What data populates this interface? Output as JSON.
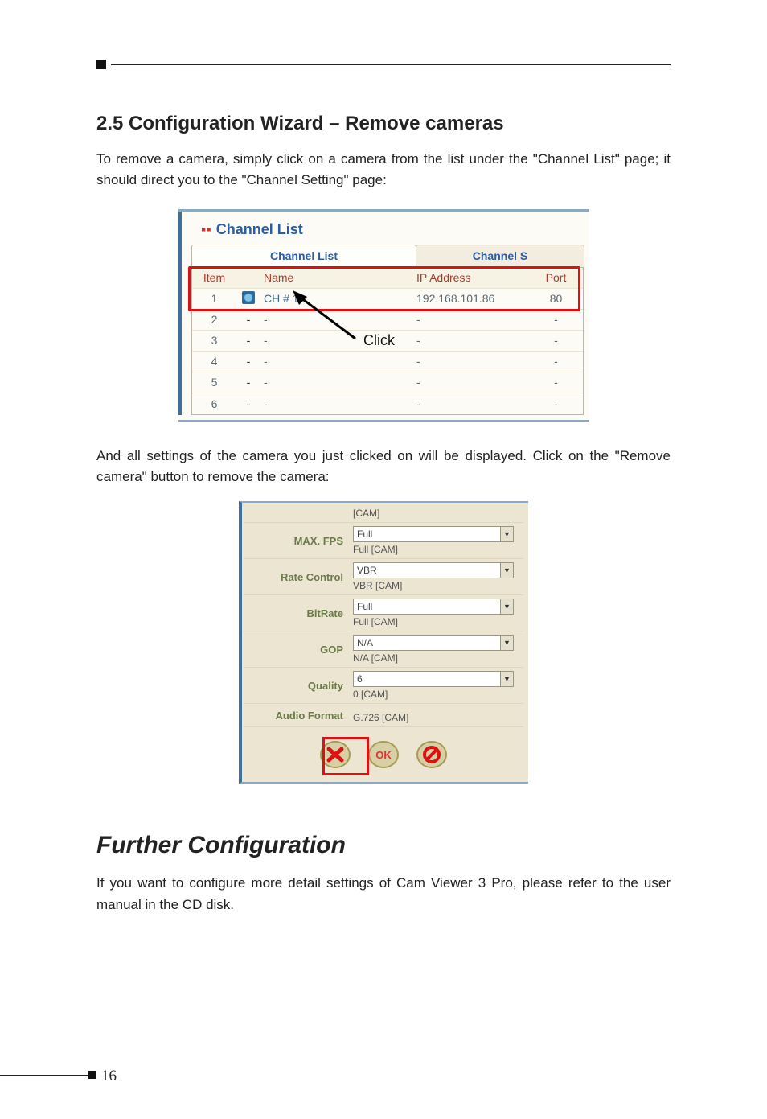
{
  "section_heading": "2.5  Configuration Wizard – Remove cameras",
  "para1": "To remove a camera, simply click on a camera from the list under the \"Channel List\" page; it should direct you to the \"Channel Setting\" page:",
  "para2": "And all settings of the camera you just clicked on will be displayed. Click on the \"Remove camera\" button to remove the camera:",
  "further_heading": "Further Configuration",
  "para3": "If you want to configure more detail settings of Cam Viewer 3 Pro, please refer to the user manual in the CD disk.",
  "page_number": "16",
  "channel_list": {
    "title": "Channel List",
    "tab_active": "Channel List",
    "tab_other": "Channel S",
    "headers": {
      "item": "Item",
      "name": "Name",
      "ip": "IP Address",
      "port": "Port"
    },
    "rows": [
      {
        "item": "1",
        "name": "CH # 1",
        "ip": "192.168.101.86",
        "port": "80"
      },
      {
        "item": "2",
        "name": "-",
        "ip": "-",
        "port": "-"
      },
      {
        "item": "3",
        "name": "-",
        "ip": "-",
        "port": "-"
      },
      {
        "item": "4",
        "name": "-",
        "ip": "-",
        "port": "-"
      },
      {
        "item": "5",
        "name": "-",
        "ip": "-",
        "port": "-"
      },
      {
        "item": "6",
        "name": "-",
        "ip": "-",
        "port": "-"
      }
    ],
    "click_label": "Click"
  },
  "settings": {
    "top_cam": "[CAM]",
    "rows": [
      {
        "label": "MAX. FPS",
        "value": "Full",
        "sub": "Full [CAM]"
      },
      {
        "label": "Rate Control",
        "value": "VBR",
        "sub": "VBR [CAM]"
      },
      {
        "label": "BitRate",
        "value": "Full",
        "sub": "Full [CAM]"
      },
      {
        "label": "GOP",
        "value": "N/A",
        "sub": "N/A [CAM]"
      },
      {
        "label": "Quality",
        "value": "6",
        "sub": "0 [CAM]"
      }
    ],
    "audio_label": "Audio Format",
    "audio_value": "G.726 [CAM]",
    "btn_ok": "OK"
  }
}
